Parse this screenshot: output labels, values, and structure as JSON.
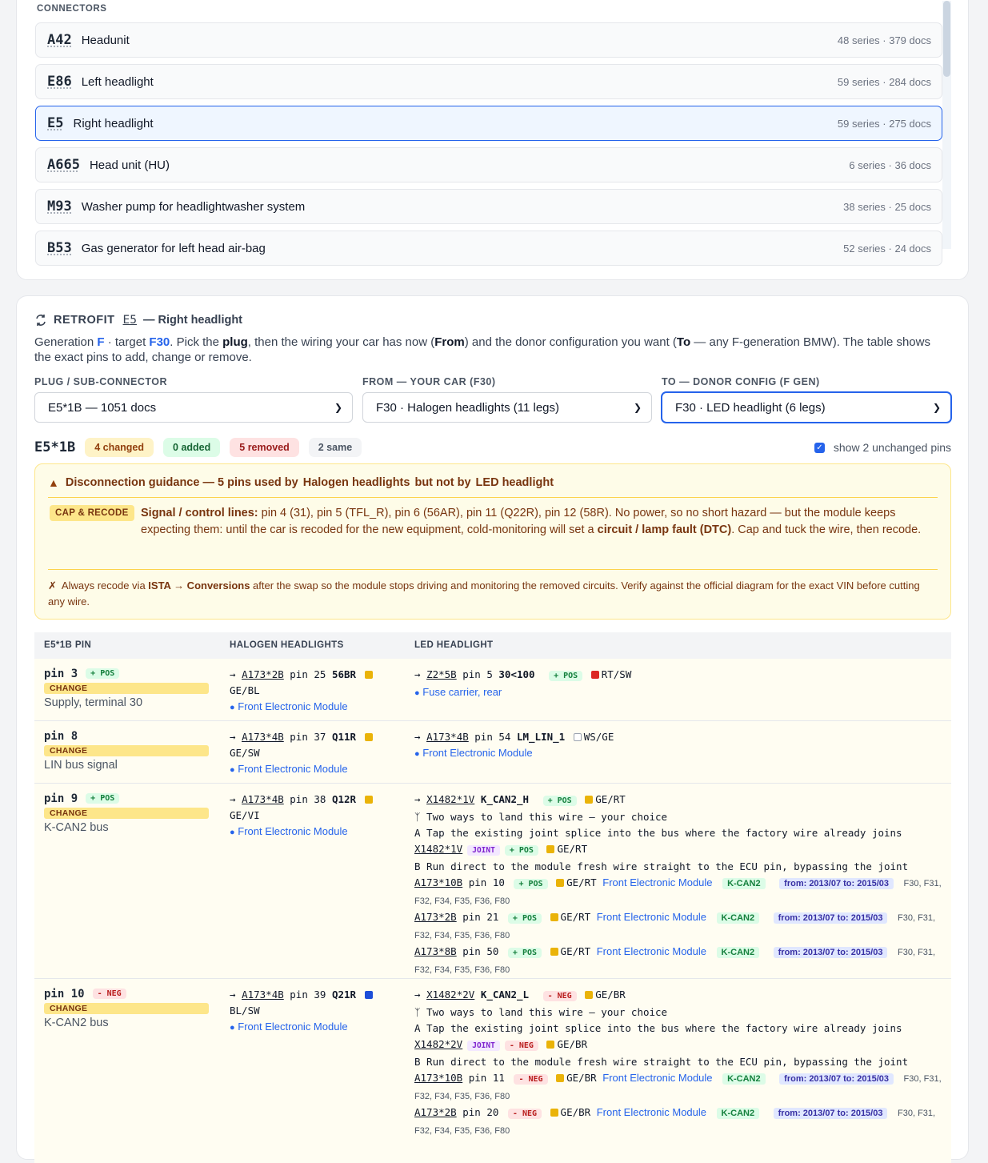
{
  "connectors": {
    "section_label": "CONNECTORS",
    "items": [
      {
        "code": "A42",
        "name": "Headunit",
        "meta": "48 series · 379 docs"
      },
      {
        "code": "E86",
        "name": "Left headlight",
        "meta": "59 series · 284 docs"
      },
      {
        "code": "E5",
        "name": "Right headlight",
        "meta": "59 series · 275 docs"
      },
      {
        "code": "A665",
        "name": "Head unit (HU)",
        "meta": "6 series · 36 docs"
      },
      {
        "code": "M93",
        "name": "Washer pump for headlightwasher system",
        "meta": "38 series · 25 docs"
      },
      {
        "code": "B53",
        "name": "Gas generator for left head air-bag",
        "meta": "52 series · 24 docs"
      }
    ]
  },
  "retrofit": {
    "title": "RETROFIT",
    "code": "E5",
    "subtitle": "— Right headlight",
    "intro": {
      "t1": "Generation ",
      "gen": "F",
      "t2": " · target ",
      "target": "F30",
      "t3": ". Pick the ",
      "plug": "plug",
      "t4": ", then the wiring your car has now (",
      "from": "From",
      "t5": ") and the donor configuration you want (",
      "to": "To",
      "t6": " — any F-generation BMW). The table shows the exact pins to add, change or remove."
    },
    "plug_label": "PLUG / SUB-CONNECTOR",
    "plug_value": "E5*1B — 1051 docs",
    "from_label": "FROM — YOUR CAR (F30)",
    "from_value": "F30 · Halogen headlights (11 legs)",
    "to_label": "TO — DONOR CONFIG (F GEN)",
    "to_value": "F30 · LED headlight (6 legs)",
    "summary": {
      "plug": "E5*1B",
      "changed": "4 changed",
      "added": "0 added",
      "removed": "5 removed",
      "same": "2 same",
      "show_unchanged": "show 2 unchanged pins"
    },
    "guidance": {
      "h1": "Disconnection guidance — 5 pins used by",
      "h2": "Halogen headlights",
      "h3": "but not by",
      "h4": "LED headlight",
      "badge": "CAP & RECODE",
      "b1": "Signal / control lines:",
      "b2": " pin 4 (31), pin 5 (TFL_R), pin 6 (56AR), pin 11 (Q22R), pin 12 (58R). No power, so no short hazard — but the module keeps expecting them: until the car is recoded for the new equipment, cold-monitoring will set a ",
      "b3": "circuit / lamp fault (DTC)",
      "b4": ". Cap and tuck the wire, then recode.",
      "f1": "Always recode via ",
      "f2": "ISTA → Conversions",
      "f3": " after the swap so the module stops driving and monitoring the removed circuits. Verify against the official diagram for the exact VIN before cutting any wire."
    },
    "table": {
      "headers": [
        "E5*1B PIN",
        "HALOGEN HEADLIGHTS",
        "LED HEADLIGHT"
      ],
      "change_label": "CHANGE",
      "rows": [
        {
          "pin": "pin 3",
          "pol": "+ POS",
          "desc": "Supply, terminal 30",
          "from": {
            "conn": "A173*2B",
            "pinno": "pin 25",
            "sig": "56BR",
            "color": "GE/BL",
            "swatch": "#eab308",
            "loc": "Front Electronic Module"
          },
          "to": {
            "conn": "Z2*5B",
            "pinno": "pin 5",
            "sig": "30<100",
            "pol": "+ POS",
            "color": "RT/SW",
            "swatch": "#dc2626",
            "loc": "Fuse carrier, rear"
          }
        },
        {
          "pin": "pin 8",
          "pol": "",
          "desc": "LIN bus signal",
          "from": {
            "conn": "A173*4B",
            "pinno": "pin 37",
            "sig": "Q11R",
            "color": "GE/SW",
            "swatch": "#eab308",
            "loc": "Front Electronic Module"
          },
          "to": {
            "conn": "A173*4B",
            "pinno": "pin 54",
            "sig": "LM_LIN_1",
            "color": "WS/GE",
            "swatch": "#ffffff",
            "loc": "Front Electronic Module"
          }
        },
        {
          "pin": "pin 9",
          "pol": "+ POS",
          "desc": "K-CAN2 bus",
          "from": {
            "conn": "A173*4B",
            "pinno": "pin 38",
            "sig": "Q12R",
            "color": "GE/VI",
            "swatch": "#eab308",
            "loc": "Front Electronic Module"
          },
          "to": {
            "conn": "X1482*1V",
            "sig": "K_CAN2_H",
            "pol": "+ POS",
            "color": "GE/RT",
            "swatch": "#eab308",
            "two_ways": "Two ways to land this wire — your choice",
            "optA": "A Tap the existing joint splice into the bus where the factory wire already joins",
            "joint": "X1482*1V",
            "joint_label": "JOINT",
            "optB": "B Run direct to the module fresh wire straight to the ECU pin, bypassing the joint",
            "direct": [
              {
                "conn": "A173*10B",
                "pinno": "pin 10",
                "loc": "Front Electronic Module",
                "bus": "K-CAN2",
                "date": "from: 2013/07 to: 2015/03",
                "s1": "F30, F31,",
                "s2": "F32, F34, F35, F36, F80"
              },
              {
                "conn": "A173*2B",
                "pinno": "pin 21",
                "loc": "Front Electronic Module",
                "bus": "K-CAN2",
                "date": "from: 2013/07 to: 2015/03",
                "s1": "F30, F31,",
                "s2": "F32, F34, F35, F36, F80"
              },
              {
                "conn": "A173*8B",
                "pinno": "pin 50",
                "loc": "Front Electronic Module",
                "bus": "K-CAN2",
                "date": "from: 2013/07 to: 2015/03",
                "s1": "F30, F31,",
                "s2": "F32, F34, F35, F36, F80"
              }
            ]
          }
        },
        {
          "pin": "pin 10",
          "pol": "- NEG",
          "desc": "K-CAN2 bus",
          "from": {
            "conn": "A173*4B",
            "pinno": "pin 39",
            "sig": "Q21R",
            "color": "BL/SW",
            "swatch": "#1d4ed8",
            "loc": "Front Electronic Module"
          },
          "to": {
            "conn": "X1482*2V",
            "sig": "K_CAN2_L",
            "pol": "- NEG",
            "color": "GE/BR",
            "swatch": "#eab308",
            "two_ways": "Two ways to land this wire — your choice",
            "optA": "A Tap the existing joint splice into the bus where the factory wire already joins",
            "joint": "X1482*2V",
            "joint_label": "JOINT",
            "optB": "B Run direct to the module fresh wire straight to the ECU pin, bypassing the joint",
            "direct": [
              {
                "conn": "A173*10B",
                "pinno": "pin 11",
                "loc": "Front Electronic Module",
                "bus": "K-CAN2",
                "date": "from: 2013/07 to: 2015/03",
                "s1": "F30, F31,",
                "s2": "F32, F34, F35, F36, F80"
              },
              {
                "conn": "A173*2B",
                "pinno": "pin 20",
                "loc": "Front Electronic Module",
                "bus": "K-CAN2",
                "date": "from: 2013/07 to: 2015/03",
                "s1": "F30, F31,",
                "s2": "F32, F34, F35, F36, F80"
              }
            ]
          }
        }
      ]
    }
  }
}
